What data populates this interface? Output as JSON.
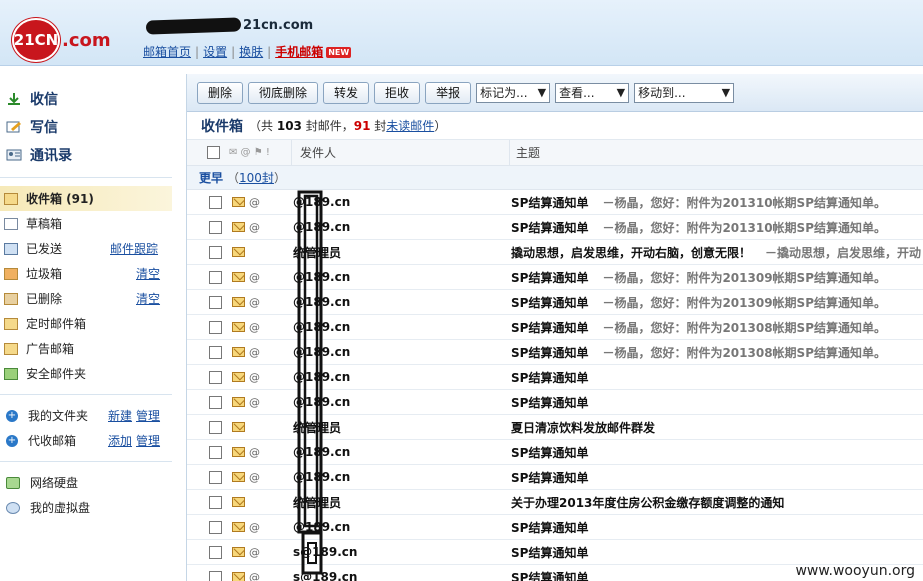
{
  "header": {
    "logo_text": "21CN",
    "logo_suffix": ".com",
    "account": "21cn.com",
    "links": [
      "邮箱首页",
      "设置",
      "换肤"
    ],
    "mobile_link": "手机邮箱",
    "new_badge": "NEW"
  },
  "sidebar": {
    "main": [
      {
        "label": "收信",
        "icon": "download-arrow-icon"
      },
      {
        "label": "写信",
        "icon": "compose-icon"
      },
      {
        "label": "通讯录",
        "icon": "contacts-icon"
      }
    ],
    "folders": [
      {
        "label": "收件箱 (91)",
        "icon": "inbox-icon",
        "active": true
      },
      {
        "label": "草稿箱",
        "icon": "drafts-icon"
      },
      {
        "label": "已发送",
        "icon": "sent-icon",
        "action": "邮件跟踪"
      },
      {
        "label": "垃圾箱",
        "icon": "spam-icon",
        "action": "清空"
      },
      {
        "label": "已删除",
        "icon": "trash-icon",
        "action": "清空"
      },
      {
        "label": "定时邮件箱",
        "icon": "scheduled-icon"
      },
      {
        "label": "广告邮箱",
        "icon": "ads-icon"
      },
      {
        "label": "安全邮件夹",
        "icon": "secure-folder-icon"
      }
    ],
    "my_folders": {
      "label": "我的文件夹",
      "a1": "新建",
      "a2": "管理"
    },
    "proxy": {
      "label": "代收邮箱",
      "a1": "添加",
      "a2": "管理"
    },
    "disk": "网络硬盘",
    "vdisk": "我的虚拟盘"
  },
  "toolbar": {
    "buttons": [
      "删除",
      "彻底删除",
      "转发",
      "拒收",
      "举报"
    ],
    "selects": [
      "标记为...",
      "查看...",
      "移动到..."
    ]
  },
  "inbox": {
    "title": "收件箱",
    "pre": "（共",
    "total": "103",
    "mid": "封邮件，",
    "unread": "91",
    "post": "封",
    "unread_link": "未读邮件",
    "end": "）"
  },
  "table": {
    "col_sender": "发件人",
    "col_subject": "主题",
    "group_label": "更早",
    "group_open": "（",
    "group_count": "100封",
    "group_close": "）"
  },
  "rows": [
    {
      "sender": "@189.cn",
      "subject": "SP结算通知单",
      "preview": "－杨晶，您好：附件为201310帐期SP结算通知单。",
      "clip": true
    },
    {
      "sender": "@189.cn",
      "subject": "SP结算通知单",
      "preview": "－杨晶，您好：附件为201310帐期SP结算通知单。",
      "clip": true
    },
    {
      "sender": "统管理员",
      "subject": "撬动思想，启发思维，开动右脑，创意无限！",
      "preview": "－撬动思想，启发思维，开动",
      "clip": false
    },
    {
      "sender": "@189.cn",
      "subject": "SP结算通知单",
      "preview": "－杨晶，您好：附件为201309帐期SP结算通知单。",
      "clip": true
    },
    {
      "sender": "@189.cn",
      "subject": "SP结算通知单",
      "preview": "－杨晶，您好：附件为201309帐期SP结算通知单。",
      "clip": true
    },
    {
      "sender": "@189.cn",
      "subject": "SP结算通知单",
      "preview": "－杨晶，您好：附件为201308帐期SP结算通知单。",
      "clip": true
    },
    {
      "sender": "@189.cn",
      "subject": "SP结算通知单",
      "preview": "－杨晶，您好：附件为201308帐期SP结算通知单。",
      "clip": true
    },
    {
      "sender": "@189.cn",
      "subject": "SP结算通知单",
      "preview": "",
      "clip": true
    },
    {
      "sender": "@189.cn",
      "subject": "SP结算通知单",
      "preview": "",
      "clip": true
    },
    {
      "sender": "统管理员",
      "subject": "夏日清凉饮料发放邮件群发",
      "preview": "",
      "clip": false
    },
    {
      "sender": "@189.cn",
      "subject": "SP结算通知单",
      "preview": "",
      "clip": true
    },
    {
      "sender": "@189.cn",
      "subject": "SP结算通知单",
      "preview": "",
      "clip": true
    },
    {
      "sender": "统管理员",
      "subject": "关于办理2013年度住房公积金缴存额度调整的通知",
      "preview": "",
      "clip": false
    },
    {
      "sender": "@189.cn",
      "subject": "SP结算通知单",
      "preview": "",
      "clip": true
    },
    {
      "sender": "s@189.cn",
      "subject": "SP结算通知单",
      "preview": "",
      "clip": true
    },
    {
      "sender": "s@189.cn",
      "subject": "SP结算通知单",
      "preview": "",
      "clip": true
    }
  ],
  "watermark": "www.wooyun.org"
}
